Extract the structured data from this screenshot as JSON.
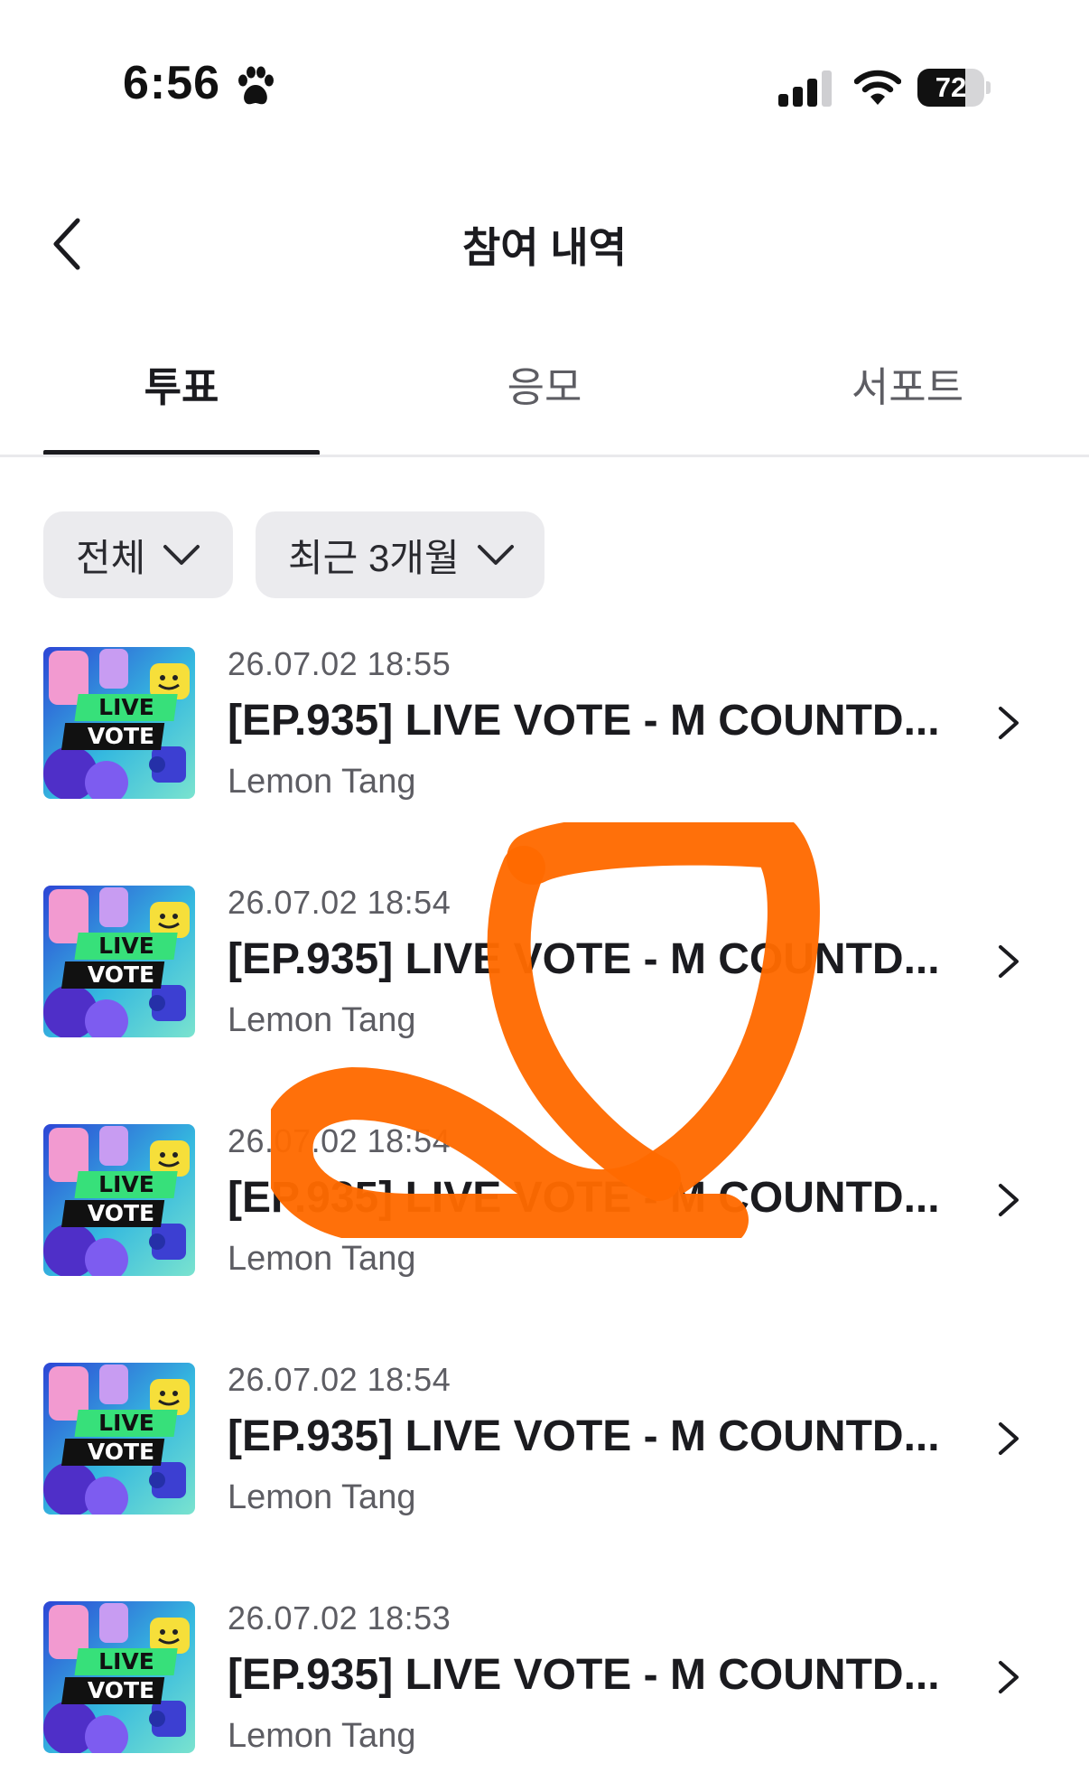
{
  "status_bar": {
    "time": "6:56",
    "battery": "72",
    "battery_level": 0.72,
    "icons": [
      "paw-icon",
      "cellular-signal-icon",
      "wifi-icon",
      "battery-icon"
    ]
  },
  "header": {
    "title": "참여 내역",
    "back_icon": "chevron-left-icon"
  },
  "tabs": [
    {
      "label": "투표",
      "active": true
    },
    {
      "label": "응모",
      "active": false
    },
    {
      "label": "서포트",
      "active": false
    }
  ],
  "filters": {
    "category": "전체",
    "period": "최근 3개월"
  },
  "list": {
    "items": [
      {
        "date": "26.07.02 18:55",
        "title": "[EP.935] LIVE VOTE - M COUNTD...",
        "artist": "Lemon Tang",
        "thumbnail": [
          "LIVE",
          "VOTE"
        ]
      },
      {
        "date": "26.07.02 18:54",
        "title": "[EP.935] LIVE VOTE - M COUNTD...",
        "artist": "Lemon Tang",
        "thumbnail": [
          "LIVE",
          "VOTE"
        ]
      },
      {
        "date": "26.07.02 18:54",
        "title": "[EP.935] LIVE VOTE - M COUNTD...",
        "artist": "Lemon Tang",
        "thumbnail": [
          "LIVE",
          "VOTE"
        ]
      },
      {
        "date": "26.07.02 18:54",
        "title": "[EP.935] LIVE VOTE - M COUNTD...",
        "artist": "Lemon Tang",
        "thumbnail": [
          "LIVE",
          "VOTE"
        ]
      },
      {
        "date": "26.07.02 18:53",
        "title": "[EP.935] LIVE VOTE - M COUNTD...",
        "artist": "Lemon Tang",
        "thumbnail": [
          "LIVE",
          "VOTE"
        ]
      }
    ]
  },
  "colors": {
    "text_primary": "#1b1b1f",
    "text_secondary": "#5d5d63",
    "filter_bg": "#ebebee",
    "scribble": "#ff6a00",
    "thumb_bg_teal": "#3ec9d6",
    "thumb_bg_blue": "#2f4bd8",
    "thumb_label_green": "#37e07a"
  }
}
